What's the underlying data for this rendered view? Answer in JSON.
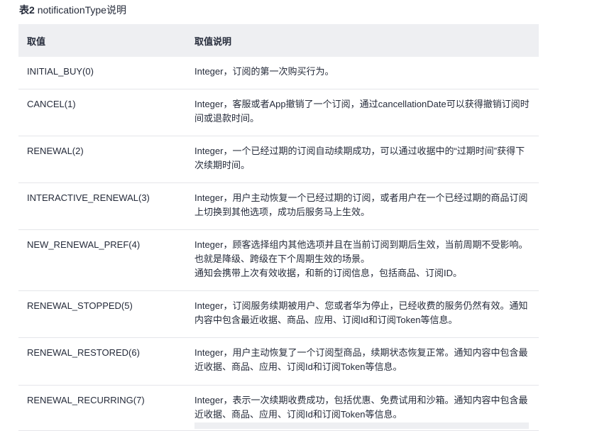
{
  "caption": {
    "number": "表2",
    "text": "notificationType说明"
  },
  "table": {
    "headers": [
      "取值",
      "取值说明"
    ],
    "rows": [
      {
        "value": "INITIAL_BUY(0)",
        "desc": "Integer，订阅的第一次购买行为。"
      },
      {
        "value": "CANCEL(1)",
        "desc": "Integer，客服或者App撤销了一个订阅，通过cancellationDate可以获得撤销订阅时间或退款时间。"
      },
      {
        "value": "RENEWAL(2)",
        "desc": "Integer，一个已经过期的订阅自动续期成功，可以通过收据中的“过期时间”获得下次续期时间。"
      },
      {
        "value": "INTERACTIVE_RENEWAL(3)",
        "desc": "Integer，用户主动恢复一个已经过期的订阅，或者用户在一个已经过期的商品订阅上切换到其他选项，成功后服务马上生效。"
      },
      {
        "value": "NEW_RENEWAL_PREF(4)",
        "desc": "Integer，顾客选择组内其他选项并且在当前订阅到期后生效，当前周期不受影响。也就是降级、跨级在下个周期生效的场景。",
        "desc_extra": "通知会携带上次有效收据，和新的订阅信息，包括商品、订阅ID。"
      },
      {
        "value": "RENEWAL_STOPPED(5)",
        "desc": "Integer，订阅服务续期被用户、您或者华为停止，已经收费的服务仍然有效。通知内容中包含最近收据、商品、应用、订阅Id和订阅Token等信息。"
      },
      {
        "value": "RENEWAL_RESTORED(6)",
        "desc": "Integer，用户主动恢复了一个订阅型商品，续期状态恢复正常。通知内容中包含最近收据、商品、应用、订阅Id和订阅Token等信息。"
      },
      {
        "value": "RENEWAL_RECURRING(7)",
        "desc": "Integer，表示一次续期收费成功，包括优惠、免费试用和沙箱。通知内容中包含最近收据、商品、应用、订阅Id和订阅Token等信息。"
      }
    ]
  }
}
